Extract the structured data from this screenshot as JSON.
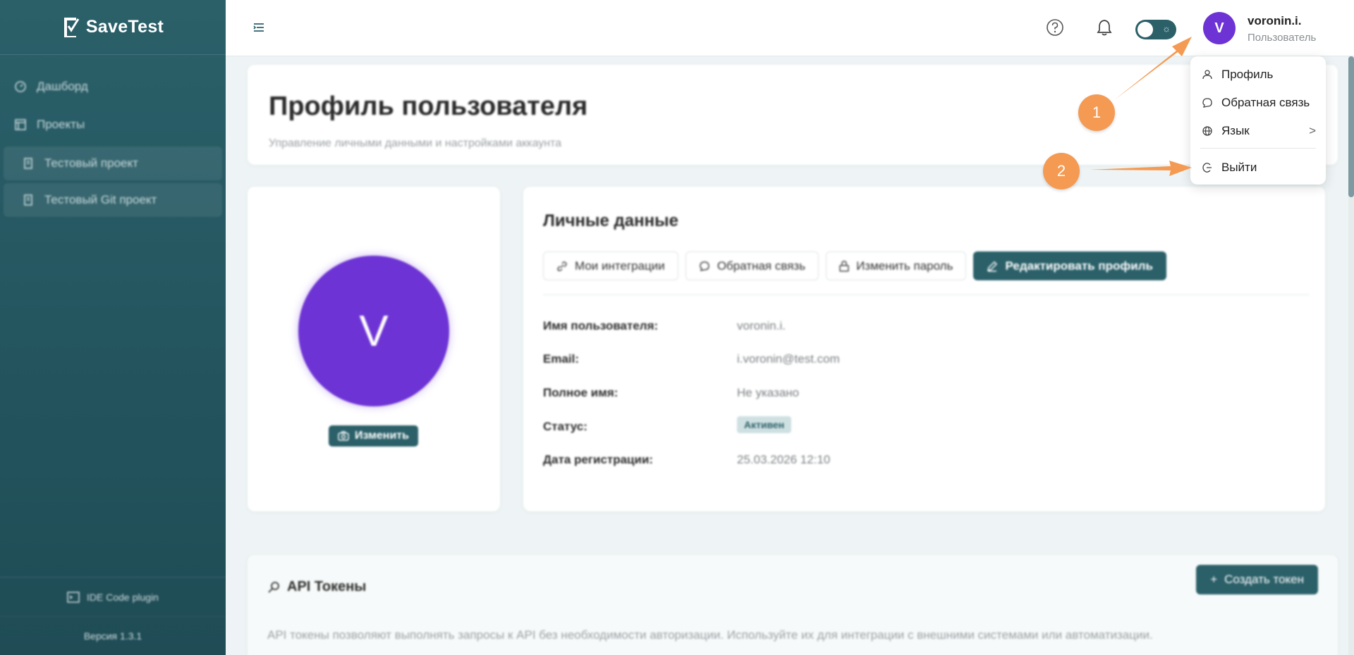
{
  "sidebar": {
    "logo": "SaveTest",
    "nav": [
      {
        "label": "Дашборд",
        "icon": "dashboard-icon"
      },
      {
        "label": "Проекты",
        "icon": "projects-icon"
      }
    ],
    "projects": [
      {
        "label": "Тестовый проект",
        "icon": "project-icon"
      },
      {
        "label": "Тестовый Git проект",
        "icon": "project-icon"
      }
    ],
    "plugin_label": "IDE Code plugin",
    "version": "Версия 1.3.1"
  },
  "topbar": {
    "avatar_letter": "V",
    "username": "voronin.i.",
    "role": "Пользователь"
  },
  "user_menu": {
    "profile": "Профиль",
    "feedback": "Обратная связь",
    "language": "Язык",
    "language_arrow": ">",
    "logout": "Выйти"
  },
  "page": {
    "title": "Профиль пользователя",
    "subtitle": "Управление личными данными и настройками аккаунта"
  },
  "avatar_card": {
    "letter": "V",
    "change_label": "Изменить"
  },
  "personal": {
    "title": "Личные данные",
    "buttons": {
      "integrations": "Мои интеграции",
      "feedback": "Обратная связь",
      "change_password": "Изменить пароль",
      "edit_profile": "Редактировать профиль"
    },
    "fields": [
      {
        "label": "Имя пользователя:",
        "value": "voronin.i."
      },
      {
        "label": "Email:",
        "value": "i.voronin@test.com"
      },
      {
        "label": "Полное имя:",
        "value": "Не указано"
      },
      {
        "label": "Статус:",
        "value": "Активен"
      },
      {
        "label": "Дата регистрации:",
        "value": "25.03.2026 12:10"
      }
    ]
  },
  "tokens": {
    "title": "API Токены",
    "create_label": "Создать токен",
    "description": "API токены позволяют выполнять запросы к API без необходимости авторизации. Используйте их для интеграции с внешними системами или автоматизации."
  },
  "annotations": [
    "1",
    "2"
  ],
  "colors": {
    "accent": "#2b6069",
    "avatar": "#6d33d4",
    "annotation": "#f49a52"
  }
}
